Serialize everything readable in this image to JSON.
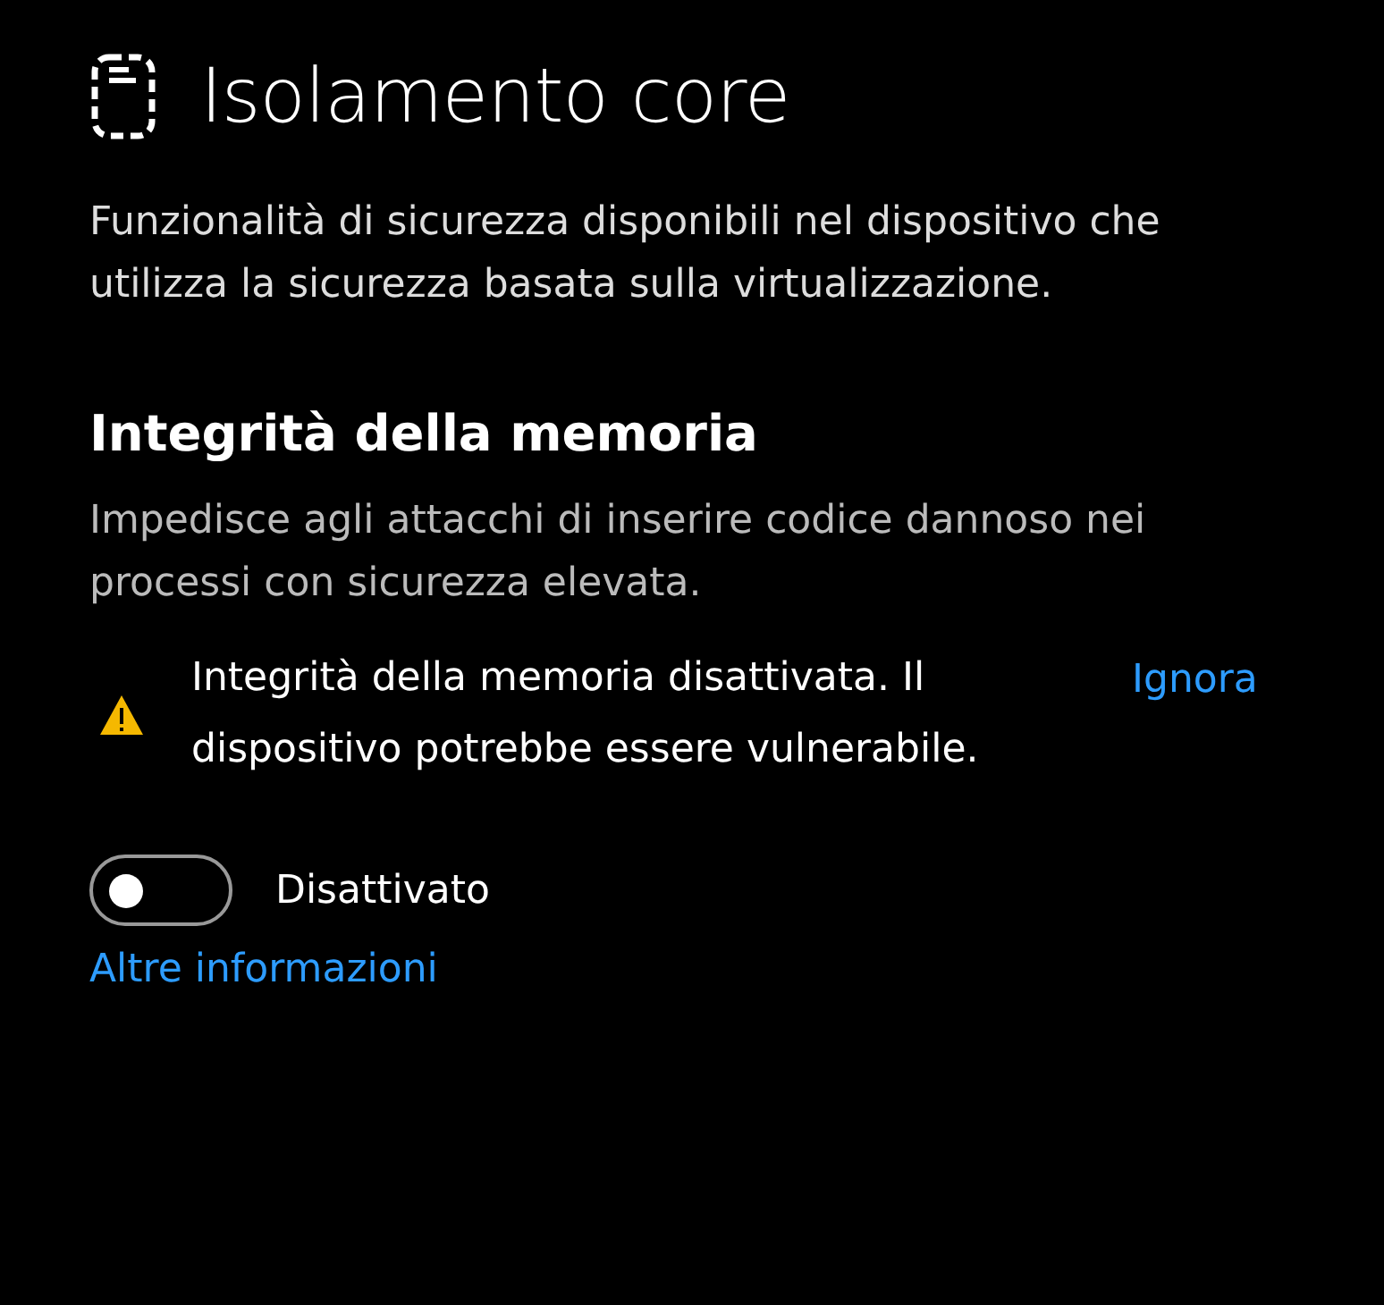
{
  "title": "Isolamento core",
  "description": "Funzionalità di sicurezza disponibili nel dispositivo che utilizza la sicurezza basata sulla virtualizzazione.",
  "section": {
    "heading": "Integrità della memoria",
    "description": "Impedisce agli attacchi di inserire codice dannoso nei processi con sicurezza elevata.",
    "warning": {
      "text": "Integrità della memoria disattivata. Il dispositivo potrebbe essere vulnerabile.",
      "action": "Ignora"
    },
    "toggle": {
      "on": false,
      "label": "Disattivato"
    },
    "link": "Altre informazioni"
  }
}
